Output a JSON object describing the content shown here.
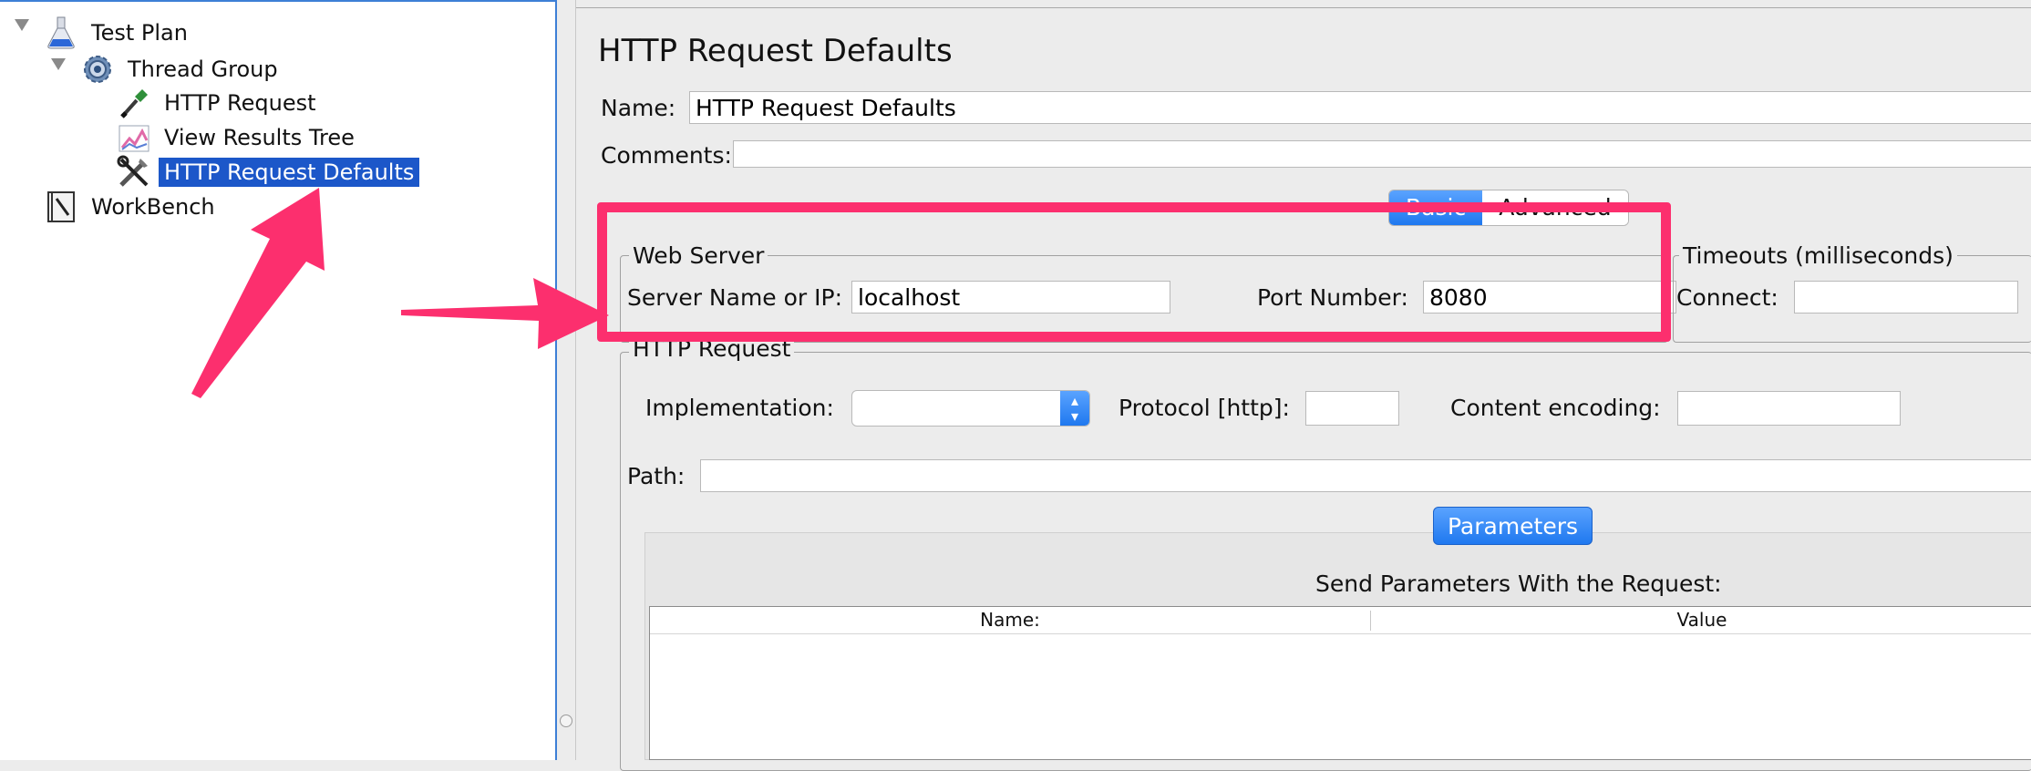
{
  "tree": {
    "nodes": [
      {
        "label": "Test Plan",
        "icon": "flask-icon",
        "expanded": true
      },
      {
        "label": "Thread Group",
        "icon": "gear-icon",
        "expanded": true
      },
      {
        "label": "HTTP Request",
        "icon": "pipette-icon"
      },
      {
        "label": "View Results Tree",
        "icon": "chart-icon"
      },
      {
        "label": "HTTP Request Defaults",
        "icon": "tools-icon",
        "selected": true
      },
      {
        "label": "WorkBench",
        "icon": "notebook-icon"
      }
    ]
  },
  "config": {
    "title": "HTTP Request Defaults",
    "name_label": "Name:",
    "name_value": "HTTP Request Defaults",
    "comments_label": "Comments:",
    "comments_value": "",
    "tabs": [
      "Basic",
      "Advanced"
    ],
    "active_tab": "Basic",
    "web_server": {
      "title": "Web Server",
      "server_label": "Server Name or IP:",
      "server_value": "localhost",
      "port_label": "Port Number:",
      "port_value": "8080"
    },
    "timeouts": {
      "title": "Timeouts (milliseconds)",
      "connect_label": "Connect:",
      "connect_value": ""
    },
    "http_request": {
      "title": "HTTP Request",
      "implementation_label": "Implementation:",
      "implementation_value": "",
      "protocol_label": "Protocol [http]:",
      "protocol_value": "",
      "encoding_label": "Content encoding:",
      "encoding_value": "",
      "path_label": "Path:",
      "path_value": ""
    },
    "parameters": {
      "button_label": "Parameters",
      "heading": "Send Parameters With the Request:",
      "columns": [
        "Name:",
        "Value"
      ]
    }
  },
  "colors": {
    "annotation": "#fc2f6e",
    "selection": "#1c57c9",
    "accent": "#1f78ef"
  }
}
